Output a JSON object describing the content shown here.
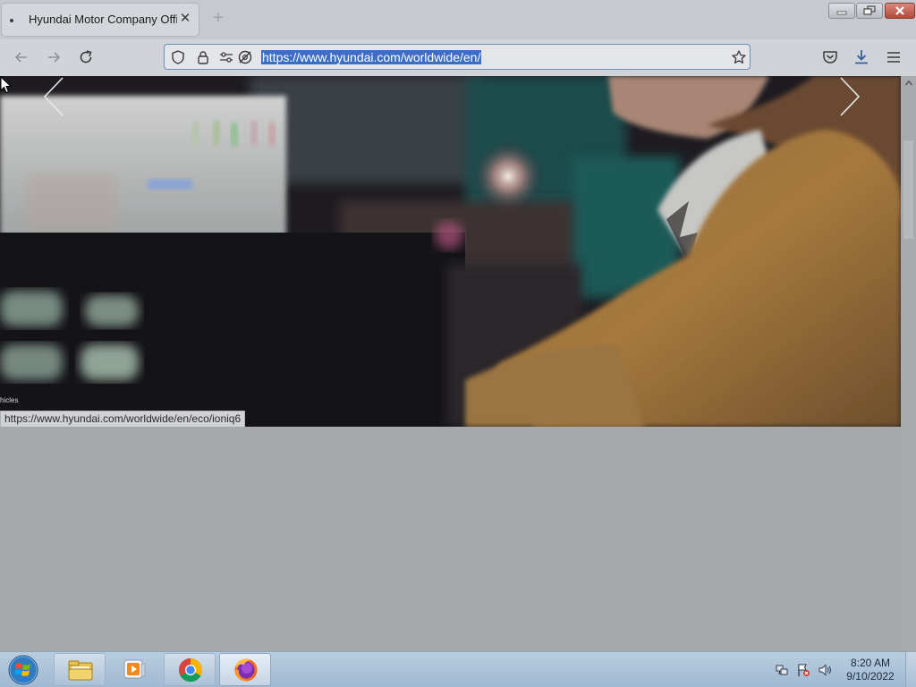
{
  "browser": {
    "tab": {
      "title": "Hyundai Motor Company Offic",
      "close_glyph": "✕"
    },
    "new_tab_glyph": "+",
    "url": "https://www.hyundai.com/worldwide/en/",
    "icons": {
      "back": "arrow-left-icon",
      "forward": "arrow-right-icon",
      "reload": "reload-icon",
      "shield": "shield-icon",
      "lock": "lock-icon",
      "permissions": "permissions-icon",
      "tracking": "tracking-blocked-icon",
      "bookmark": "star-icon",
      "pocket": "pocket-icon",
      "downloads": "download-icon",
      "menu": "hamburger-menu-icon"
    },
    "accent_color": "#3b6fc4"
  },
  "page": {
    "hero_caption": "hicles",
    "status_link": "https://www.hyundai.com/worldwide/en/eco/ioniq6"
  },
  "taskbar": {
    "clock_time": "8:20 AM",
    "clock_date": "9/10/2022",
    "apps": [
      "file-explorer-icon",
      "media-player-icon",
      "chrome-icon",
      "firefox-icon"
    ]
  }
}
